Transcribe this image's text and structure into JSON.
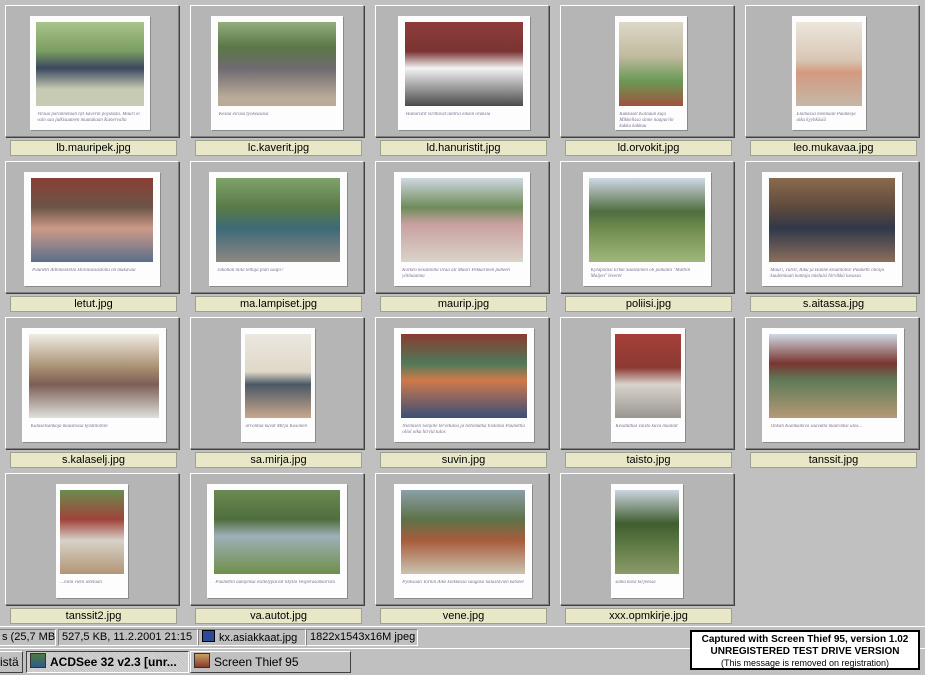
{
  "thumbnails": [
    {
      "filename": "lb.mauripek.jpg",
      "caption": "Virsua parannetaan nyt kaverin pöydästä. Mauri ei vain saa julkisuuteen muutakaan Kanervalta",
      "scene": "s1"
    },
    {
      "filename": "lc.kaverit.jpg",
      "caption": "Kesaa eirasa tyokeasasa",
      "scene": "s2"
    },
    {
      "filename": "ld.hanuristit.jpg",
      "caption": "Hanuristit virittävät iuntria eikein oraksia",
      "scene": "s3"
    },
    {
      "filename": "ld.orvokit.jpg",
      "caption": "Kukkaset Kainuun kuja Mikkelissa sinne naapuriin kukka kakkuu",
      "scene": "s4"
    },
    {
      "filename": "leo.mukavaa.jpg",
      "caption": "Elämässä mennään Paunkeja aika kyyhkäsiä",
      "scene": "s5"
    },
    {
      "filename": "letut.jpg",
      "caption": "Paunetti Aittokeskella Hiirolaosastolla on mukavaa",
      "scene": "s6"
    },
    {
      "filename": "ma.lampiset.jpg",
      "caption": "Jokohan niitä lettuja pian saapi?",
      "scene": "s7"
    },
    {
      "filename": "maurip.jpg",
      "caption": "Korkeo kesantolla ilvaa all Mauri Pekkarinen puheen yötinaanna",
      "scene": "s8"
    },
    {
      "filename": "poliisi.jpg",
      "caption": "Kylapoliisi Erkki Saastainen oli paikalla \"Mattiin Maijen\" leveret",
      "scene": "s9"
    },
    {
      "filename": "s.aitassa.jpg",
      "caption": "Mauri, Tulvit, Riku ja Hanne kesantolla! Paunetti olioija kuulemiaan kantoja mieluisi hirvikkö luvassa",
      "scene": "s10"
    },
    {
      "filename": "s.kalaselj.jpg",
      "caption": "Kalaselsankoja maastossa kylätiloihin",
      "scene": "s11"
    },
    {
      "filename": "sa.mirja.jpg",
      "caption": "arvontaa kuvat Mirja Kosonen",
      "scene": "s12"
    },
    {
      "filename": "suvin.jpg",
      "caption": "Niemisen Sonjille tervetuloa ja tietomatka tiistaina Paunettia olioi oika hirviä tulos",
      "scene": "s13"
    },
    {
      "filename": "taisto.jpg",
      "caption": "Kesätuttua Taisto kuva maalait",
      "scene": "s14"
    },
    {
      "filename": "tanssit.jpg",
      "caption": "Onkan Kiankaikiva saavutta maaraiksi ulos...",
      "scene": "s15"
    },
    {
      "filename": "tanssit2.jpg",
      "caption": "...nillä vieni iötetään",
      "scene": "s16"
    },
    {
      "filename": "va.autot.jpg",
      "caption": "Paunettin autojensa esittelypäivät likyllä Vesperasankaristo",
      "scene": "s17"
    },
    {
      "filename": "vene.jpg",
      "caption": "Pyöksaan Tornin Äike koikkessa saagaisi kalastavien katseet",
      "scene": "s18"
    },
    {
      "filename": "xxx.opmkirje.jpg",
      "caption": "sama kuva kirjeessä",
      "scene": "s19"
    }
  ],
  "statusbar": {
    "total": "s (25,7 MB)",
    "selected": "527,5 KB, 11.2.2001 21:15",
    "current_file": "kx.asiakkaat.jpg",
    "image_info": "1822x1543x16M jpeg"
  },
  "taskbar": {
    "start_fragment": "istä",
    "items": [
      {
        "label": "ACDSee 32 v2.3 [unr...",
        "icon": "acdsee-icon",
        "active": true
      },
      {
        "label": "Screen Thief 95",
        "icon": "screen-thief-icon",
        "active": false
      }
    ]
  },
  "watermark": {
    "line1": "Captured with Screen Thief 95, version 1.02",
    "line2": "UNREGISTERED TEST DRIVE VERSION",
    "line3": "(This message is removed on registration)"
  }
}
